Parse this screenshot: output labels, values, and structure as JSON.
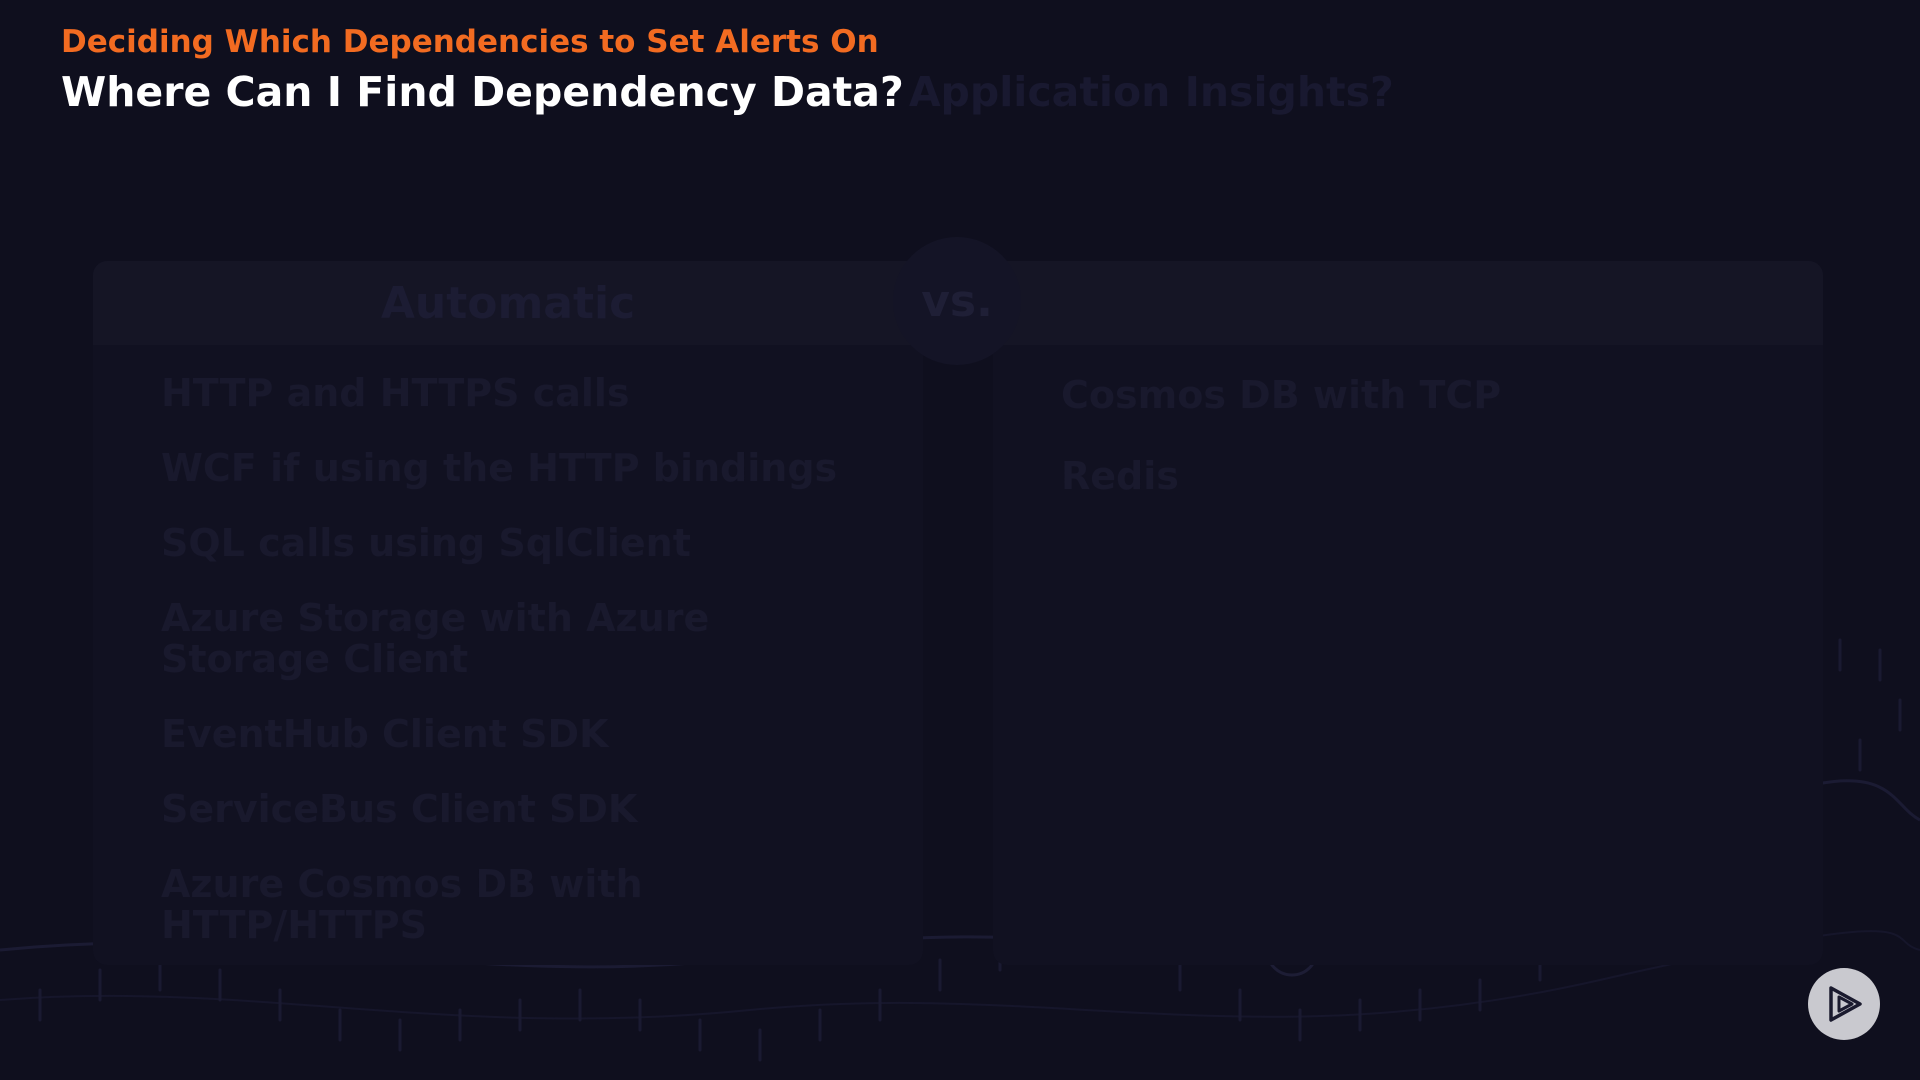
{
  "header": {
    "subtitle": "Deciding Which Dependencies to Set Alerts On",
    "title": "Where Can I Find Dependency Data?",
    "title_ghost": "Application Insights?"
  },
  "comparison": {
    "left_header": "Automatic",
    "vs_label": "vs.",
    "right_header": "",
    "left_items": [
      "HTTP and HTTPS calls",
      "WCF if using the HTTP bindings",
      "SQL calls using SqlClient",
      "Azure Storage with Azure Storage Client",
      "EventHub Client SDK",
      "ServiceBus Client SDK",
      "Azure Cosmos DB with HTTP/HTTPS"
    ],
    "right_items": [
      "Cosmos DB with TCP",
      "Redis"
    ]
  },
  "player": {
    "play_icon": "play-logo-icon"
  },
  "colors": {
    "background": "#0f0f1e",
    "accent": "#f26b21",
    "title": "#ffffff"
  }
}
